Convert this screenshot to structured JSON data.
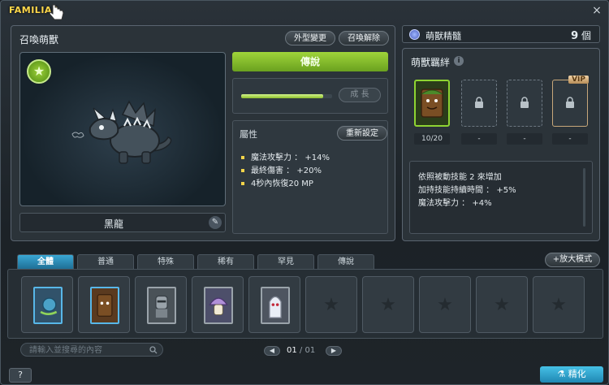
{
  "window": {
    "title": "FAMILIAR",
    "close_label": "×"
  },
  "familiar": {
    "panel_title": "召喚萌獸",
    "appearance_button": "外型變更",
    "release_button": "召喚解除",
    "name": "黑龍",
    "rarity": "傳說",
    "growth_button": "成 長",
    "growth_progress": 0.9,
    "attributes_title": "屬性",
    "reset_button": "重新設定",
    "attributes": [
      "魔法攻擊力 ： +14%",
      "最終傷害 ： +20%",
      "4秒內恢復20 MP"
    ]
  },
  "essence": {
    "label": "萌獸精髓",
    "count": "9",
    "unit": "個"
  },
  "bond": {
    "title": "萌獸羈絆",
    "info_icon": "i",
    "slots": [
      {
        "state": "filled",
        "value": "10/20"
      },
      {
        "state": "locked",
        "value": "-"
      },
      {
        "state": "locked",
        "value": "-"
      },
      {
        "state": "vip",
        "value": "-",
        "tag": "VIP"
      }
    ],
    "effects": [
      "依照被動技能 2 來增加",
      "加持技能持續時間 ： +5%",
      "魔法攻擊力 ： +4%"
    ]
  },
  "tabs": [
    "全體",
    "普通",
    "特殊",
    "稀有",
    "罕見",
    "傳說"
  ],
  "zoom_button": "+放大模式",
  "search": {
    "placeholder": "請輸入並搜尋的內容"
  },
  "pager": {
    "current": "01",
    "separator": "/",
    "total": "01",
    "prev": "◀",
    "next": "▶"
  },
  "help_button": "?",
  "refine_button": "精化",
  "colors": {
    "accent_green": "#8fd432",
    "accent_blue": "#2c9ccc",
    "title_yellow": "#ffd84a"
  }
}
